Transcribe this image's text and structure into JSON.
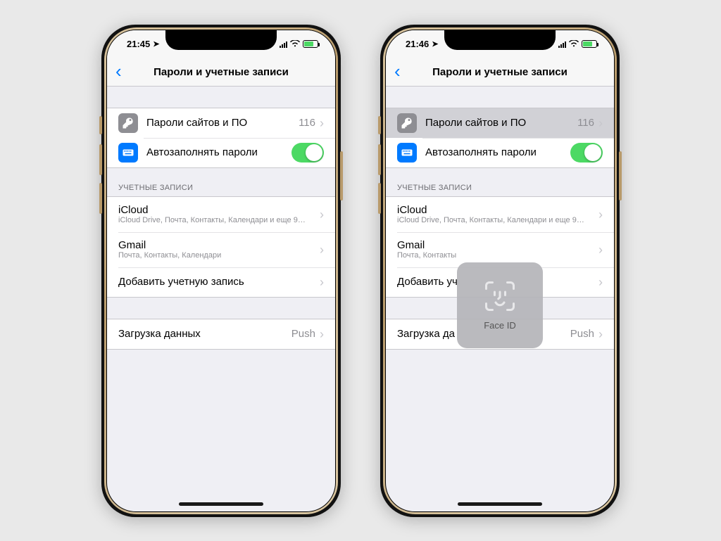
{
  "phones": [
    {
      "time": "21:45",
      "nav_title": "Пароли и учетные записи",
      "website_passwords": {
        "label": "Пароли сайтов и ПО",
        "count": "116",
        "pressed": false
      },
      "autofill": {
        "label": "Автозаполнять пароли",
        "on": true
      },
      "accounts_header": "УЧЕТНЫЕ ЗАПИСИ",
      "accounts": [
        {
          "title": "iCloud",
          "sub": "iCloud Drive, Почта, Контакты, Календари и еще 9…"
        },
        {
          "title": "Gmail",
          "sub": "Почта, Контакты, Календари"
        }
      ],
      "add_account": "Добавить учетную запись",
      "fetch": {
        "label": "Загрузка данных",
        "value": "Push"
      },
      "faceid": null
    },
    {
      "time": "21:46",
      "nav_title": "Пароли и учетные записи",
      "website_passwords": {
        "label": "Пароли сайтов и ПО",
        "count": "116",
        "pressed": true
      },
      "autofill": {
        "label": "Автозаполнять пароли",
        "on": true
      },
      "accounts_header": "УЧЕТНЫЕ ЗАПИСИ",
      "accounts": [
        {
          "title": "iCloud",
          "sub": "iCloud Drive, Почта, Контакты, Календари и еще 9…"
        },
        {
          "title": "Gmail",
          "sub": "Почта, Контакты"
        }
      ],
      "add_account": "Добавить уч",
      "fetch": {
        "label": "Загрузка да",
        "value": "Push"
      },
      "faceid": {
        "label": "Face ID"
      }
    }
  ]
}
